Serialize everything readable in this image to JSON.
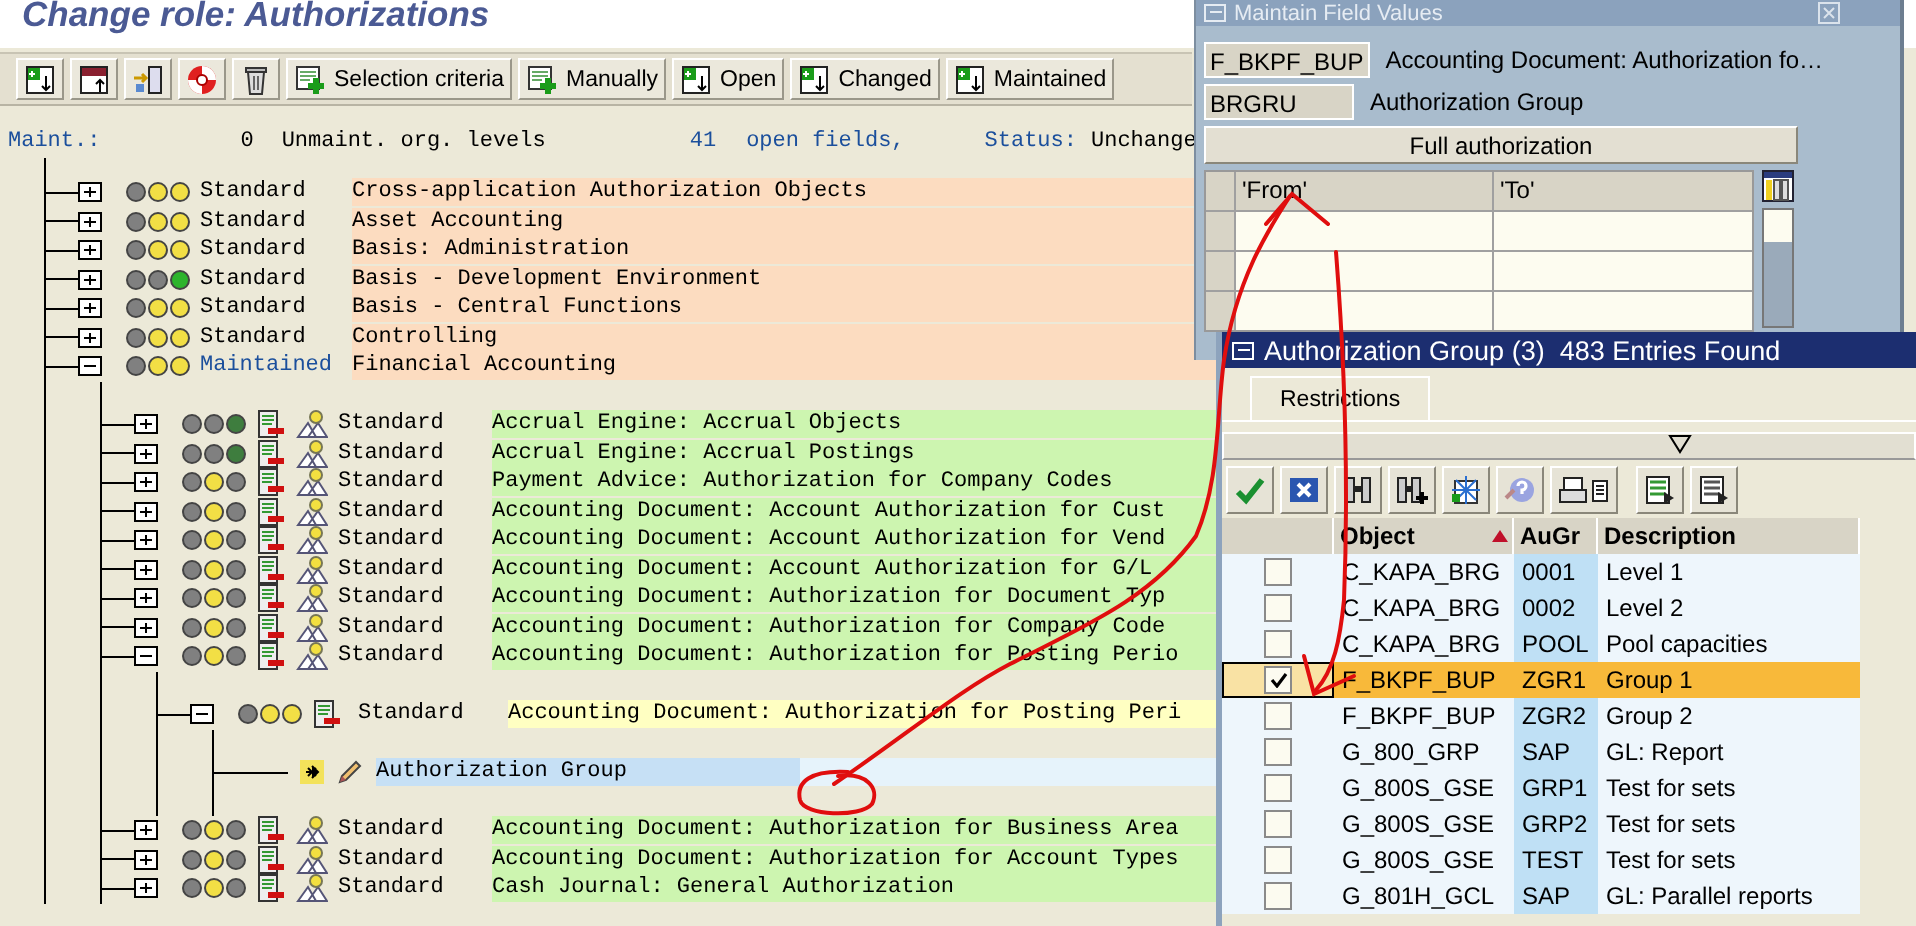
{
  "title": "Change role: Authorizations",
  "toolbar": [
    {
      "label": "Selection criteria",
      "kind": "add"
    },
    {
      "label": "Manually",
      "kind": "add"
    },
    {
      "label": "Open",
      "kind": "download"
    },
    {
      "label": "Changed",
      "kind": "download"
    },
    {
      "label": "Maintained",
      "kind": "download"
    }
  ],
  "status_line": {
    "maint_label": "Maint.:",
    "maint_count": "0",
    "unmaint_label": "Unmaint. org. levels",
    "open_count": "41",
    "open_label": "open fields,",
    "status_label": "Status:",
    "status_value": "Unchange"
  },
  "tree": [
    {
      "kind": "class",
      "expanded": false,
      "maintained": false,
      "status": "Standard",
      "text": "Cross-application Authorization Objects",
      "lights": [
        {
          "color": "#808080"
        },
        {
          "color": "#f2df45"
        },
        {
          "color": "#f2df45"
        }
      ]
    },
    {
      "kind": "class",
      "expanded": false,
      "maintained": false,
      "status": "Standard",
      "text": "Asset Accounting",
      "lights": [
        {
          "color": "#808080"
        },
        {
          "color": "#f2df45"
        },
        {
          "color": "#f2df45"
        }
      ]
    },
    {
      "kind": "class",
      "expanded": false,
      "maintained": false,
      "status": "Standard",
      "text": "Basis: Administration",
      "lights": [
        {
          "color": "#808080"
        },
        {
          "color": "#f2df45"
        },
        {
          "color": "#f2df45"
        }
      ]
    },
    {
      "kind": "class",
      "expanded": false,
      "maintained": false,
      "status": "Standard",
      "text": "Basis - Development Environment",
      "lights": [
        {
          "color": "#808080"
        },
        {
          "color": "#808080"
        },
        {
          "color": "#2db42d"
        }
      ]
    },
    {
      "kind": "class",
      "expanded": false,
      "maintained": false,
      "status": "Standard",
      "text": "Basis - Central Functions",
      "lights": [
        {
          "color": "#808080"
        },
        {
          "color": "#f2df45"
        },
        {
          "color": "#f2df45"
        }
      ]
    },
    {
      "kind": "class",
      "expanded": false,
      "maintained": false,
      "status": "Standard",
      "text": "Controlling",
      "lights": [
        {
          "color": "#808080"
        },
        {
          "color": "#f2df45"
        },
        {
          "color": "#f2df45"
        }
      ]
    },
    {
      "kind": "class",
      "expanded": true,
      "maintained": true,
      "status": "Maintained",
      "text": "Financial Accounting",
      "lights": [
        {
          "color": "#808080"
        },
        {
          "color": "#f2df45"
        },
        {
          "color": "#f2df45"
        }
      ],
      "children": [
        {
          "kind": "object",
          "expanded": false,
          "status": "Standard",
          "text": "Accrual Engine: Accrual Objects",
          "lights": [
            {
              "color": "#808080"
            },
            {
              "color": "#808080"
            },
            {
              "color": "#3e7d3e"
            }
          ]
        },
        {
          "kind": "object",
          "expanded": false,
          "status": "Standard",
          "text": "Accrual Engine: Accrual Postings",
          "lights": [
            {
              "color": "#808080"
            },
            {
              "color": "#808080"
            },
            {
              "color": "#3e7d3e"
            }
          ]
        },
        {
          "kind": "object",
          "expanded": false,
          "status": "Standard",
          "text": "Payment Advice: Authorization for Company Codes",
          "lights": [
            {
              "color": "#808080"
            },
            {
              "color": "#f2df45"
            },
            {
              "color": "#808080"
            }
          ]
        },
        {
          "kind": "object",
          "expanded": false,
          "status": "Standard",
          "text": "Accounting Document: Account Authorization for Cust",
          "lights": [
            {
              "color": "#808080"
            },
            {
              "color": "#f2df45"
            },
            {
              "color": "#808080"
            }
          ]
        },
        {
          "kind": "object",
          "expanded": false,
          "status": "Standard",
          "text": "Accounting Document: Account Authorization for Vend",
          "lights": [
            {
              "color": "#808080"
            },
            {
              "color": "#f2df45"
            },
            {
              "color": "#808080"
            }
          ]
        },
        {
          "kind": "object",
          "expanded": false,
          "status": "Standard",
          "text": "Accounting Document: Account Authorization for G/L",
          "lights": [
            {
              "color": "#808080"
            },
            {
              "color": "#f2df45"
            },
            {
              "color": "#808080"
            }
          ]
        },
        {
          "kind": "object",
          "expanded": false,
          "status": "Standard",
          "text": "Accounting Document: Authorization for Document Typ",
          "lights": [
            {
              "color": "#808080"
            },
            {
              "color": "#f2df45"
            },
            {
              "color": "#808080"
            }
          ]
        },
        {
          "kind": "object",
          "expanded": false,
          "status": "Standard",
          "text": "Accounting Document: Authorization for Company Code",
          "lights": [
            {
              "color": "#808080"
            },
            {
              "color": "#f2df45"
            },
            {
              "color": "#808080"
            }
          ]
        },
        {
          "kind": "object",
          "expanded": true,
          "status": "Standard",
          "text": "Accounting Document: Authorization for Posting Perio",
          "lights": [
            {
              "color": "#808080"
            },
            {
              "color": "#f2df45"
            },
            {
              "color": "#808080"
            }
          ],
          "children": [
            {
              "kind": "authorization",
              "expanded": true,
              "status": "Standard",
              "text": "Accounting Document: Authorization for Posting Peri",
              "lights": [
                {
                  "color": "#808080"
                },
                {
                  "color": "#f2df45"
                },
                {
                  "color": "#f2df45"
                }
              ],
              "children": [
                {
                  "kind": "field",
                  "text": "Authorization Group"
                }
              ]
            }
          ]
        },
        {
          "kind": "object",
          "expanded": false,
          "status": "Standard",
          "text": "Accounting Document: Authorization for Business Area",
          "lights": [
            {
              "color": "#808080"
            },
            {
              "color": "#f2df45"
            },
            {
              "color": "#808080"
            }
          ]
        },
        {
          "kind": "object",
          "expanded": false,
          "status": "Standard",
          "text": "Accounting Document: Authorization for Account Types",
          "lights": [
            {
              "color": "#808080"
            },
            {
              "color": "#f2df45"
            },
            {
              "color": "#808080"
            }
          ]
        },
        {
          "kind": "object",
          "expanded": false,
          "status": "Standard",
          "text": "Cash Journal: General Authorization",
          "lights": [
            {
              "color": "#808080"
            },
            {
              "color": "#f2df45"
            },
            {
              "color": "#808080"
            }
          ]
        }
      ]
    }
  ],
  "field_dialog": {
    "title": "Maintain Field Values",
    "object_code": "F_BKPF_BUP",
    "object_text": "Accounting Document: Authorization fo…",
    "field_code": "BRGRU",
    "field_text": "Authorization Group",
    "full_button": "Full authorization",
    "columns": [
      "'From'",
      "'To'"
    ]
  },
  "value_dialog": {
    "title": "Authorization Group (3)  483 Entries Found",
    "tabs": [
      {
        "label": "Restrictions",
        "selected": true
      }
    ],
    "columns": [
      "Object",
      "AuGr",
      "Description"
    ],
    "rows": [
      {
        "object": "C_KAPA_BRG",
        "group": "0001",
        "description": "Level 1",
        "checked": false,
        "selected": false
      },
      {
        "object": "C_KAPA_BRG",
        "group": "0002",
        "description": "Level 2",
        "checked": false,
        "selected": false
      },
      {
        "object": "C_KAPA_BRG",
        "group": "POOL",
        "description": "Pool capacities",
        "checked": false,
        "selected": false
      },
      {
        "object": "F_BKPF_BUP",
        "group": "ZGR1",
        "description": "Group 1",
        "checked": true,
        "selected": true
      },
      {
        "object": "F_BKPF_BUP",
        "group": "ZGR2",
        "description": "Group 2",
        "checked": false,
        "selected": false
      },
      {
        "object": "G_800_GRP",
        "group": "SAP",
        "description": "GL: Report",
        "checked": false,
        "selected": false
      },
      {
        "object": "G_800S_GSE",
        "group": "GRP1",
        "description": "Test for sets",
        "checked": false,
        "selected": false
      },
      {
        "object": "G_800S_GSE",
        "group": "GRP2",
        "description": "Test for sets",
        "checked": false,
        "selected": false
      },
      {
        "object": "G_800S_GSE",
        "group": "TEST",
        "description": "Test for sets",
        "checked": false,
        "selected": false
      },
      {
        "object": "G_801H_GCL",
        "group": "SAP",
        "description": "GL: Parallel reports",
        "checked": false,
        "selected": false
      }
    ]
  }
}
